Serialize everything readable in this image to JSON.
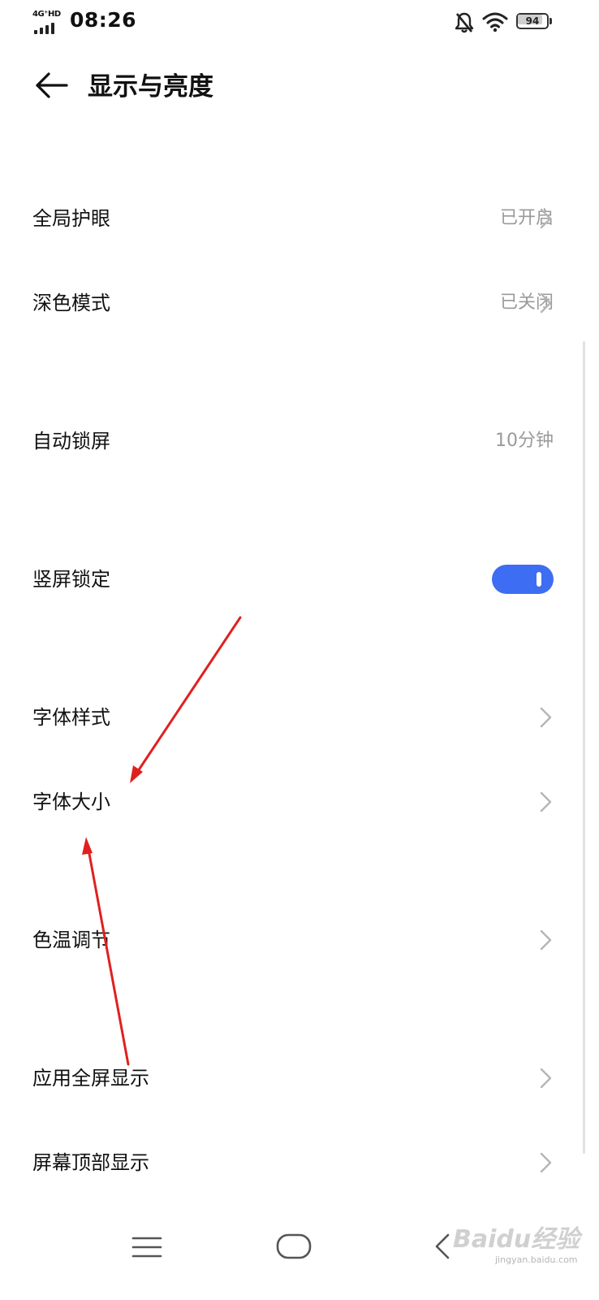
{
  "status_bar": {
    "network_type": "4G⁺HD",
    "time": "08:26",
    "battery_level": "94",
    "battery_fraction": 0.94,
    "icons": [
      "signal-icon",
      "bell-muted-icon",
      "wifi-icon",
      "battery-icon"
    ]
  },
  "header": {
    "back_icon": "back-arrow-icon",
    "title": "显示与亮度"
  },
  "settings": [
    {
      "label": "全局护眼",
      "value": "已开启",
      "chevron": true
    },
    {
      "label": "深色模式",
      "value": "已关闭",
      "chevron": true
    },
    {
      "label": "自动锁屏",
      "value": "10分钟",
      "chevron": false
    },
    {
      "label": "竖屏锁定",
      "toggle_on": true
    },
    {
      "label": "字体样式",
      "chevron": true
    },
    {
      "label": "字体大小",
      "chevron": true
    },
    {
      "label": "色温调节",
      "chevron": true
    },
    {
      "label": "应用全屏显示",
      "chevron": true
    },
    {
      "label": "屏幕顶部显示",
      "chevron": true
    }
  ],
  "nav_bar": {
    "icons": [
      "menu-icon",
      "home-icon",
      "back-icon"
    ]
  },
  "watermark": {
    "text": "Baidu经验",
    "sub": "jingyan.baidu.com"
  },
  "colors": {
    "accent": "#3d6df2",
    "annotation_arrow": "#e02020",
    "secondary_text": "#9a9a9a"
  }
}
